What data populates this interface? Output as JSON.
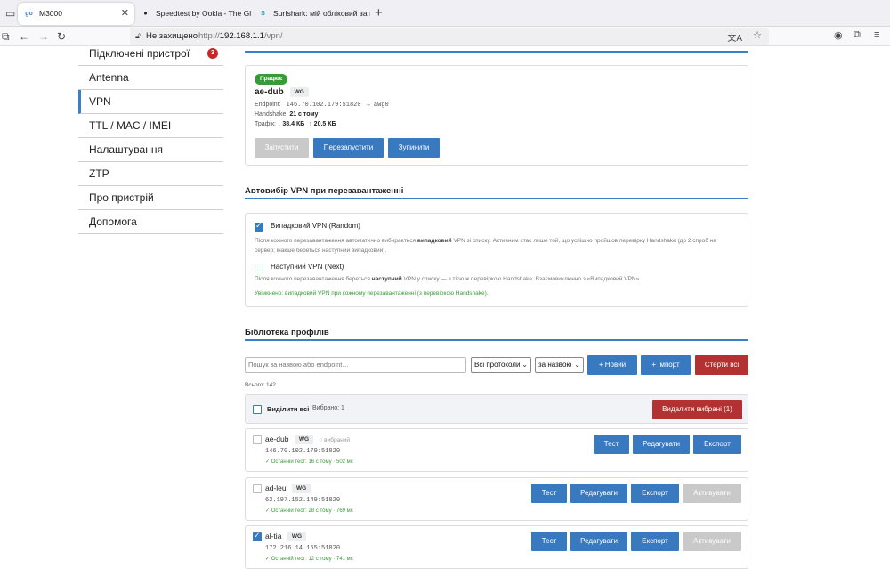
{
  "browser": {
    "tabs": [
      {
        "label": "M3000",
        "fav": "go"
      },
      {
        "label": "Speedtest by Ookla - The Globa",
        "fav": "●"
      },
      {
        "label": "Surfshark: мій обліковий запис",
        "fav": "S"
      }
    ],
    "not_secure": "Не захищено",
    "url_prefix": "http://",
    "url_host": "192.168.1.1",
    "url_path": "/vpn/"
  },
  "sidebar": {
    "items": [
      {
        "label": "Підключені пристрої",
        "badge": "3"
      },
      {
        "label": "Antenna"
      },
      {
        "label": "VPN"
      },
      {
        "label": "TTL / MAC / IMEI"
      },
      {
        "label": "Налаштування"
      },
      {
        "label": "ZTP"
      },
      {
        "label": "Про пристрій"
      },
      {
        "label": "Допомога"
      }
    ]
  },
  "status": {
    "badge": "Працює",
    "name": "ae-dub",
    "type": "WG",
    "endpoint_label": "Endpoint:",
    "endpoint": "146.70.102.179:51820",
    "iface": "→ awg0",
    "handshake_label": "Handshake:",
    "handshake": "21 с тому",
    "traffic_label": "Трафік:",
    "rx": "↓ 38.4 КБ",
    "tx": "↑ 20.5 КБ",
    "btn_start": "Запустити",
    "btn_restart": "Перезапустити",
    "btn_stop": "Зупинити"
  },
  "autoselect": {
    "title": "Автовибір VPN при перезавантаженні",
    "random_label": "Випадковий VPN (Random)",
    "random_desc_1": "Після кожного перезавантаження автоматично вибирається ",
    "random_desc_b": "випадковий",
    "random_desc_2": " VPN зі списку. Активним стає лише той, що успішно пройшов перевірку Handshake (до 2 спроб на",
    "random_desc_3": "сервер; інакше береться наступний випадковий).",
    "next_label": "Наступний VPN (Next)",
    "next_desc_1": "Після кожного перезавантаження береться ",
    "next_desc_b": "наступний",
    "next_desc_2": " VPN у списку — з тією ж перевіркою Handshake. Взаємовиключно з «Випадковий VPN».",
    "enabled_note": "Увімкнено: випадковий VPN при кожному перезавантаженні (з перевіркою Handshake)."
  },
  "library": {
    "title": "Бібліотека профілів",
    "search_placeholder": "Пошук за назвою або endpoint…",
    "protocol_select": "Всі протоколи",
    "sort_select": "за назвою",
    "btn_new": "+ Новий",
    "btn_import": "+ Імпорт",
    "btn_clear": "Стерти всі",
    "total": "Всього: 142",
    "select_all": "Виділити всі",
    "selected": "Вибрано: 1",
    "btn_delete_selected": "Видалити вибрані (1)",
    "profiles": [
      {
        "name": "ae-dub",
        "type": "WG",
        "tag": "○ вибраний",
        "endpoint": "146.70.102.179:51820",
        "last": "✓ Останній тест: 16 с тому · 502 мс",
        "test": "Тест",
        "edit": "Редагувати",
        "export": "Експорт",
        "activate": ""
      },
      {
        "name": "ad-leu",
        "type": "WG",
        "tag": "",
        "endpoint": "62.197.152.149:51820",
        "last": "✓ Останній тест: 28 с тому · 769 мс",
        "test": "Тест",
        "edit": "Редагувати",
        "export": "Експорт",
        "activate": "Активувати"
      },
      {
        "name": "al-tia",
        "type": "WG",
        "tag": "",
        "endpoint": "172.216.14.165:51820",
        "last": "✓ Останній тест: 12 с тому · 741 мс",
        "test": "Тест",
        "edit": "Редагувати",
        "export": "Експорт",
        "activate": "Активувати"
      }
    ]
  }
}
